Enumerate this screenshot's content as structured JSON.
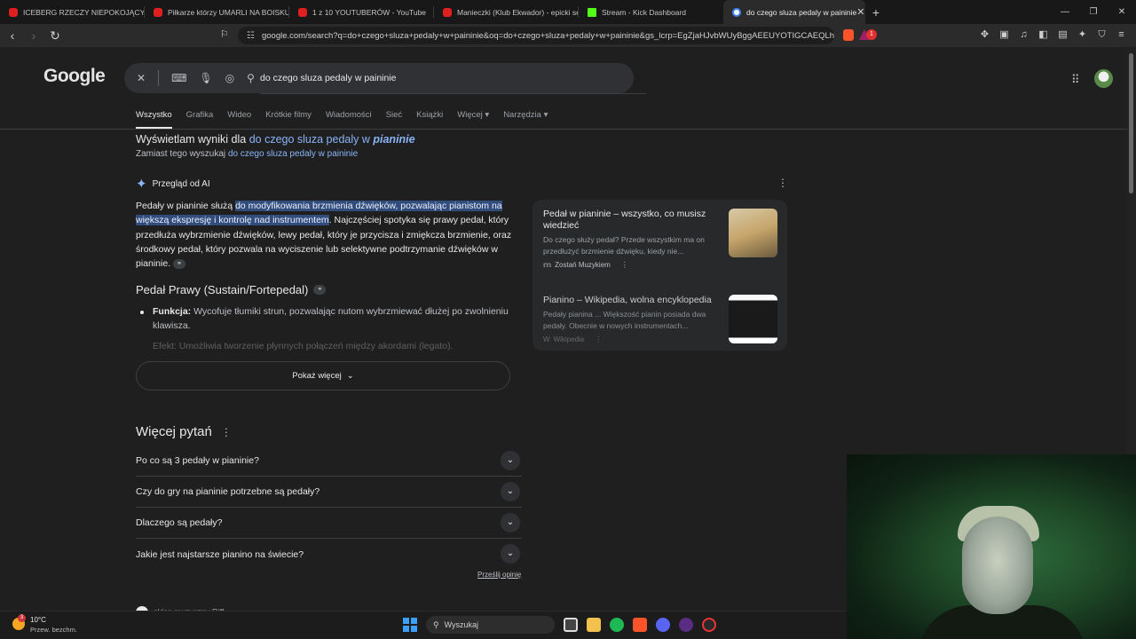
{
  "browser": {
    "tabs": [
      {
        "title": "ICEBERG RZECZY NIEPOKOJĄCYCH (",
        "icon": "youtube-icon"
      },
      {
        "title": "Piłkarze którzy UMARLI NA BOISKU",
        "icon": "youtube-icon"
      },
      {
        "title": "1 z 10 YOUTUBERÓW - YouTube",
        "icon": "youtube-icon"
      },
      {
        "title": "Manieczki (Klub Ekwador) - epicki set",
        "icon": "youtube-icon"
      },
      {
        "title": "Stream - Kick Dashboard",
        "icon": "kick-icon"
      },
      {
        "title": "do czego sluza pedaly w paininie",
        "icon": "google-icon",
        "close": "✕"
      }
    ],
    "new_tab": "+",
    "url": "google.com/search?q=do+czego+sluza+pedaly+w+paininie&oq=do+czego+sluza+pedaly+w+paininie&gs_lcrp=EgZjaHJvbWUyBggAEEUYOTIGCAEQLh...",
    "shields_count": "1"
  },
  "google": {
    "logo": "Google",
    "query": "do czego sluza pedaly w paininie",
    "tabs": [
      "Wszystko",
      "Grafika",
      "Wideo",
      "Krótkie filmy",
      "Wiadomości",
      "Sieć",
      "Książki",
      "Więcej ▾",
      "Narzędzia ▾"
    ],
    "spelling": {
      "showing_prefix": "Wyświetlam wyniki dla ",
      "showing_link": "do czego sluza pedaly w ",
      "showing_link_bold": "pianinie",
      "instead_prefix": "Zamiast tego wyszukaj ",
      "instead_link": "do czego sluza pedaly w paininie"
    },
    "ai_overview": {
      "label": "Przegląd od AI",
      "text_before": "Pedały w pianinie służą ",
      "text_highlight": "do modyfikowania brzmienia dźwięków, pozwalając pianistom na większą ekspresję i kontrolę nad instrumentem",
      "text_after": ". Najczęściej spotyka się prawy pedał, który przedłuża wybrzmienie dźwięków, lewy pedał, który je przycisza i zmiękcza brzmienie, oraz środkowy pedał, który pozwala na wyciszenie lub selektywne podtrzymanie dźwięków w pianinie.",
      "subheading": "Pedał Prawy (Sustain/Fortepedal)",
      "bullet_label": "Funkcja:",
      "bullet_text": " Wycofuje tłumiki strun, pozwalając nutom wybrzmiewać dłużej po zwolnieniu klawisza.",
      "faded_text": "Efekt: Umożliwia tworzenie płynnych połączeń między akordami (legato).",
      "show_more": "Pokaż więcej",
      "sources": [
        {
          "title": "Pedał w pianinie – wszystko, co musisz wiedzieć",
          "snippet": "Do czego służy pedał? Przede wszystkim ma on przedłużyć brzmienie dźwięku, kiedy nie...",
          "site": "Zostań Muzykiem"
        },
        {
          "title": "Pianino – Wikipedia, wolna encyklopedia",
          "snippet": "Pedały pianina ... Większość pianin posiada dwa pedały. Obecnie w nowych instrumentach...",
          "site": "Wikipedia"
        }
      ]
    },
    "more_questions": {
      "title": "Więcej pytań",
      "questions": [
        "Po co są 3 pedały w pianinie?",
        "Czy do gry na pianinie potrzebne są pedały?",
        "Dlaczego są pedały?",
        "Jakie jest najstarsze pianino na świecie?"
      ],
      "feedback": "Prześlij opinię"
    },
    "next_result_partial": "sklep muzyczny Riff"
  },
  "taskbar": {
    "weather_temp": "10°C",
    "weather_cond": "Przew. bezchm.",
    "weather_badge": "3",
    "search_placeholder": "Wyszukaj"
  }
}
